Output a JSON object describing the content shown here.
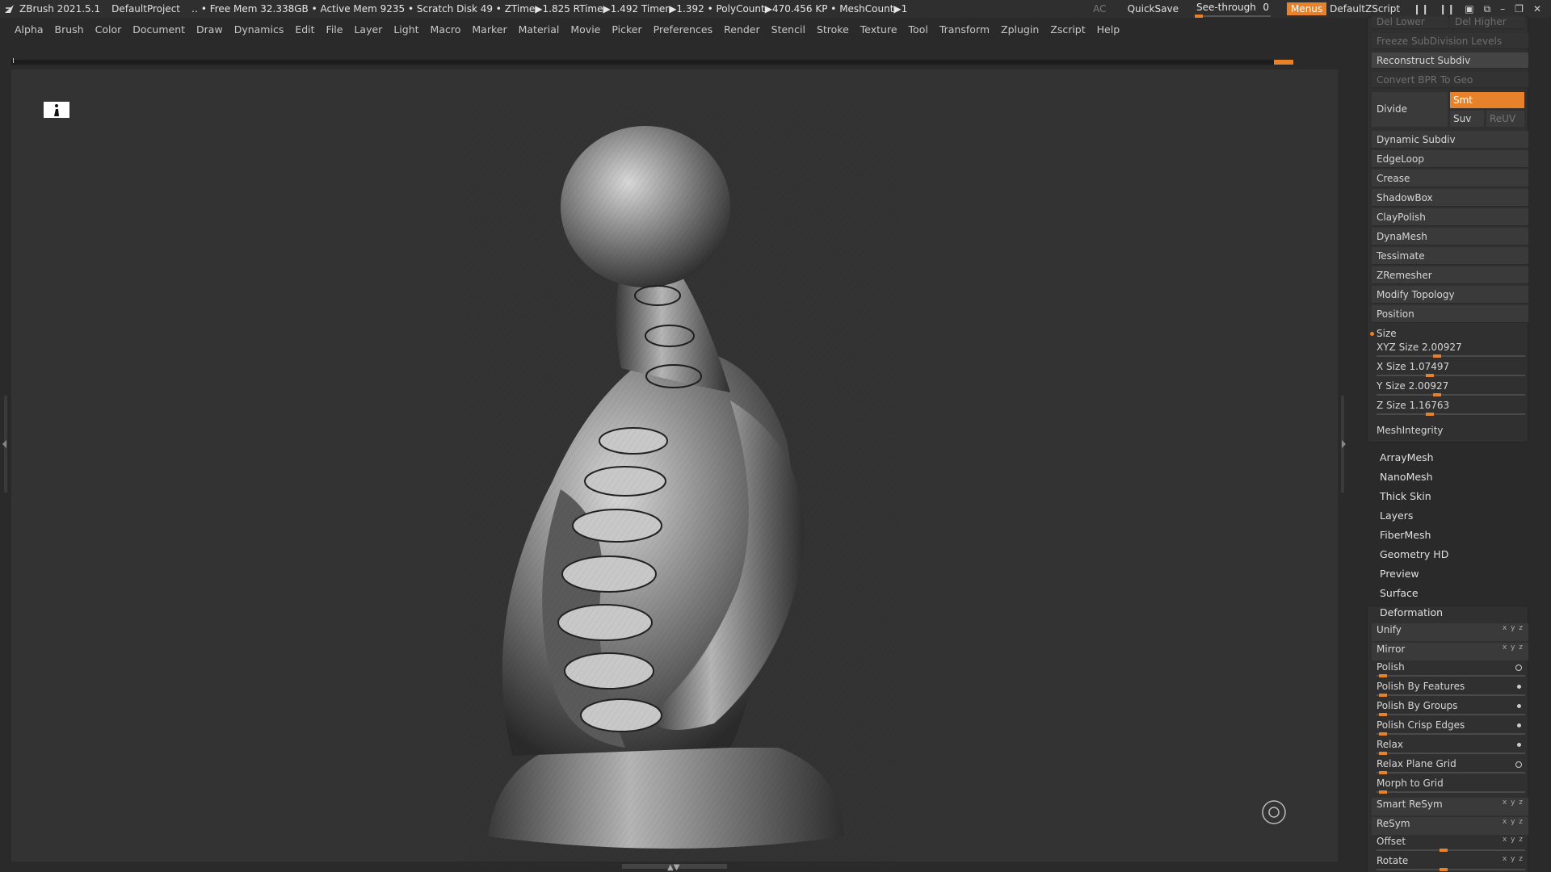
{
  "titlebar": {
    "app": "ZBrush 2021.5.1",
    "project": "DefaultProject",
    "info": "‥ • Free Mem 32.338GB • Active Mem 9235 • Scratch Disk 49 •  ZTime▶1.825 RTime▶1.492 Timer▶1.392 • PolyCount▶470.456 KP  • MeshCount▶1",
    "ac": "AC",
    "quicksave": "QuickSave",
    "seethrough_label": "See-through",
    "seethrough_value": "0",
    "menus": "Menus",
    "default_zscript": "DefaultZScript"
  },
  "menubar": [
    "Alpha",
    "Brush",
    "Color",
    "Document",
    "Draw",
    "Dynamics",
    "Edit",
    "File",
    "Layer",
    "Light",
    "Macro",
    "Marker",
    "Material",
    "Movie",
    "Picker",
    "Preferences",
    "Render",
    "Stencil",
    "Stroke",
    "Texture",
    "Tool",
    "Transform",
    "Zplugin",
    "Zscript",
    "Help"
  ],
  "panel": {
    "del_lower": "Del Lower",
    "del_higher": "Del Higher",
    "freeze": "Freeze SubDivision Levels",
    "reconstruct": "Reconstruct Subdiv",
    "convert_bpr": "Convert BPR To Geo",
    "divide": "Divide",
    "smt": "Smt",
    "suv": "Suv",
    "reuv": "ReUV",
    "subsections": [
      "Dynamic Subdiv",
      "EdgeLoop",
      "Crease",
      "ShadowBox",
      "ClayPolish",
      "DynaMesh",
      "Tessimate",
      "ZRemesher",
      "Modify Topology",
      "Position"
    ],
    "size_header": "Size",
    "sizes": [
      {
        "label": "XYZ Size",
        "value": "2.00927",
        "level": 0.4
      },
      {
        "label": "X Size",
        "value": "1.07497",
        "level": 0.35
      },
      {
        "label": "Y Size",
        "value": "2.00927",
        "level": 0.4
      },
      {
        "label": "Z Size",
        "value": "1.16763",
        "level": 0.35
      }
    ],
    "mesh_integrity": "MeshIntegrity",
    "sections": [
      "ArrayMesh",
      "NanoMesh",
      "Thick Skin",
      "Layers",
      "FiberMesh",
      "Geometry HD",
      "Preview",
      "Surface"
    ],
    "deformation_header": "Deformation",
    "deformation": [
      {
        "label": "Unify",
        "kind": "xyz",
        "xyz": "x y z"
      },
      {
        "label": "Mirror",
        "kind": "xyz",
        "xyz": "x y z"
      },
      {
        "label": "Polish",
        "kind": "dot-ring",
        "level": 0.02
      },
      {
        "label": "Polish By Features",
        "kind": "dot",
        "level": 0.02
      },
      {
        "label": "Polish By Groups",
        "kind": "dot",
        "level": 0.02
      },
      {
        "label": "Polish Crisp Edges",
        "kind": "dot",
        "level": 0.02
      },
      {
        "label": "Relax",
        "kind": "dot",
        "level": 0.02
      },
      {
        "label": "Relax Plane Grid",
        "kind": "dot-ring",
        "level": 0.02
      },
      {
        "label": "Morph to Grid",
        "kind": "none",
        "level": 0.02
      },
      {
        "label": "Smart ReSym",
        "kind": "xyz",
        "xyz": "x y z"
      },
      {
        "label": "ReSym",
        "kind": "xyz",
        "xyz": "x y z"
      },
      {
        "label": "Offset",
        "kind": "xyz-slider",
        "xyz": "x y z",
        "level": 0.45
      },
      {
        "label": "Rotate",
        "kind": "xyz-slider",
        "xyz": "x y z",
        "level": 0.45
      }
    ]
  }
}
